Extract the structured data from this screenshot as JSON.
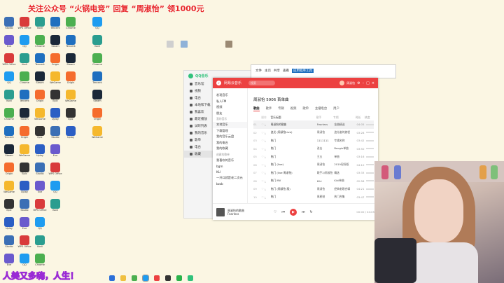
{
  "banner": {
    "part1": "关注公众号",
    "part2": "“火锅电竞”",
    "part3": "回复",
    "part4": "“周淑怡”",
    "part5": "领1000元"
  },
  "bottom_overlay": "人美又多嗨，人生！",
  "desktop_icons": [
    {
      "label": "Studio",
      "color": "#3b6fb5"
    },
    {
      "label": "Eve",
      "color": "#6a5acd"
    },
    {
      "label": "WPS Office",
      "color": "#d93b3b"
    },
    {
      "label": "QQ",
      "color": "#1e9cf0"
    },
    {
      "label": "Kodi",
      "color": "#2a9d8f"
    },
    {
      "label": "Chrome",
      "color": "#4caf50"
    },
    {
      "label": "Tencent",
      "color": "#1f6fbf"
    },
    {
      "label": "Steam",
      "color": "#1b2838"
    },
    {
      "label": "Origin",
      "color": "#f56c2d"
    },
    {
      "label": "WeGame",
      "color": "#f5b82d"
    },
    {
      "label": "Epic",
      "color": "#333333"
    },
    {
      "label": "Uplay",
      "color": "#2b5ec4"
    }
  ],
  "qq_music": {
    "title": "QQ音乐",
    "items": [
      "音乐馆",
      "视频",
      "电台",
      "本地和下载",
      "我喜欢",
      "最近播放",
      "试听列表",
      "我的音乐",
      "歌单",
      "电台",
      "收藏"
    ]
  },
  "explorer": {
    "tabs": [
      "文件",
      "主页",
      "共享",
      "查看",
      "应用程序工具"
    ]
  },
  "netease": {
    "title": "网易云音乐",
    "search_placeholder": "搜索",
    "user": "周淑怡",
    "side_top": [
      "发现音乐",
      "私人FM",
      "视频",
      "朋友"
    ],
    "side_head1": "我的音乐",
    "side_items1": [
      "本地音乐",
      "下载管理",
      "我的音乐云盘",
      "我的电台",
      "我的收藏"
    ],
    "side_head2": "创建的歌单",
    "side_items2": [
      "我喜欢的音乐",
      "bgm",
      "KLI",
      "一开口就是老二次元",
      "bzzb"
    ],
    "heading": "周淑怡 5906 首单曲",
    "tabs": [
      "歌曲",
      "歌手",
      "专辑",
      "视频",
      "歌单",
      "主播电台",
      "用户"
    ],
    "columns": [
      "",
      "操作",
      "音乐标题",
      "歌手",
      "专辑",
      "时长",
      "热度"
    ],
    "rows": [
      {
        "no": "01",
        "title": "周淑怡的歌曲",
        "artist": "Fearless",
        "album": "金曲精选",
        "dur": "04:05"
      },
      {
        "no": "02",
        "title": "追光 (周淑怡Live)",
        "artist": "周淑怡",
        "album": "追光者的旅程",
        "dur": "03:28"
      },
      {
        "no": "03",
        "title": "热门",
        "artist": "1111111",
        "album": "专辑名称",
        "dur": "03:42"
      },
      {
        "no": "04",
        "title": "热门",
        "artist": "进击",
        "album": "Boogie单曲",
        "dur": "03:50"
      },
      {
        "no": "05",
        "title": "热门",
        "artist": "王五",
        "album": "单曲",
        "dur": "03:16"
      },
      {
        "no": "06",
        "title": "热门 (live)",
        "artist": "周淑怡",
        "album": "2019现场版",
        "dur": "04:10"
      },
      {
        "no": "07",
        "title": "热门 (live 周淑怡)",
        "artist": "歌手2/周淑怡",
        "album": "精选",
        "dur": "03:33"
      },
      {
        "no": "08",
        "title": "热门 MV",
        "artist": "Kiki",
        "album": "Kiki单曲",
        "dur": "02:58"
      },
      {
        "no": "09",
        "title": "热门 (周淑怡 版)",
        "artist": "周淑怡",
        "album": "经典老歌合辑",
        "dur": "04:21"
      },
      {
        "no": "10",
        "title": "热门",
        "artist": "周星驰",
        "album": "热门合集",
        "dur": "03:47"
      },
      {
        "no": "11",
        "title": "热门",
        "artist": "二三",
        "album": "单曲",
        "dur": "03:05"
      },
      {
        "no": "12",
        "title": "热门",
        "artist": "周淑怡",
        "album": "女声合集",
        "dur": "03:55"
      }
    ],
    "player": {
      "song": "周淑怡的歌曲",
      "artist": "Fearless",
      "time": "00:00 / 04:05"
    }
  },
  "taskbar": [
    "start",
    "explorer",
    "chrome",
    "qq",
    "netease",
    "obs",
    "wechat",
    "music"
  ],
  "colors": {
    "netease_red": "#ec4141",
    "qq_green": "#31c27c",
    "banner_red": "#e8262a"
  }
}
